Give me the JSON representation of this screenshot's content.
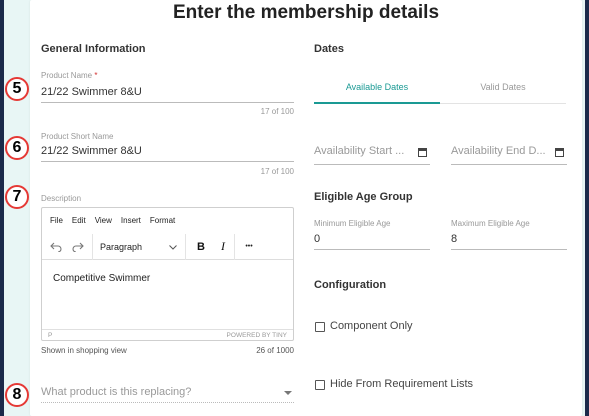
{
  "page": {
    "title": "Enter the membership details"
  },
  "general": {
    "heading": "General Information",
    "product_name": {
      "label": "Product Name",
      "required_mark": "*",
      "value": "21/22 Swimmer 8&U",
      "counter": "17 of 100"
    },
    "short_name": {
      "label": "Product Short Name",
      "value": "21/22 Swimmer 8&U",
      "counter": "17 of 100"
    },
    "description": {
      "label": "Description",
      "menu": [
        "File",
        "Edit",
        "View",
        "Insert",
        "Format"
      ],
      "block_format": "Paragraph",
      "bold": "B",
      "italic": "I",
      "more": "•••",
      "content": "Competitive Swimmer",
      "path": "P",
      "powered": "POWERED BY TINY",
      "shown_in": "Shown in shopping view",
      "counter": "26 of 1000"
    },
    "replacing": {
      "placeholder": "What product is this replacing?"
    }
  },
  "dates": {
    "heading": "Dates",
    "tabs": [
      {
        "label": "Available Dates",
        "active": true
      },
      {
        "label": "Valid Dates",
        "active": false
      }
    ],
    "start_placeholder": "Availability Start ...",
    "end_placeholder": "Availability End D..."
  },
  "age": {
    "heading": "Eligible Age Group",
    "min": {
      "label": "Minimum Eligible Age",
      "value": "0"
    },
    "max": {
      "label": "Maximum Eligible Age",
      "value": "8"
    }
  },
  "config": {
    "heading": "Configuration",
    "component_only": {
      "label": "Component Only",
      "checked": false
    },
    "hide_from_req": {
      "label": "Hide From Requirement Lists",
      "checked": false
    }
  },
  "badges": [
    "5",
    "6",
    "7",
    "8"
  ],
  "colors": {
    "accent": "#1a9a94",
    "badge_border": "#e53935",
    "frame": "#1b2a4a",
    "background": "#e8f6f5"
  }
}
